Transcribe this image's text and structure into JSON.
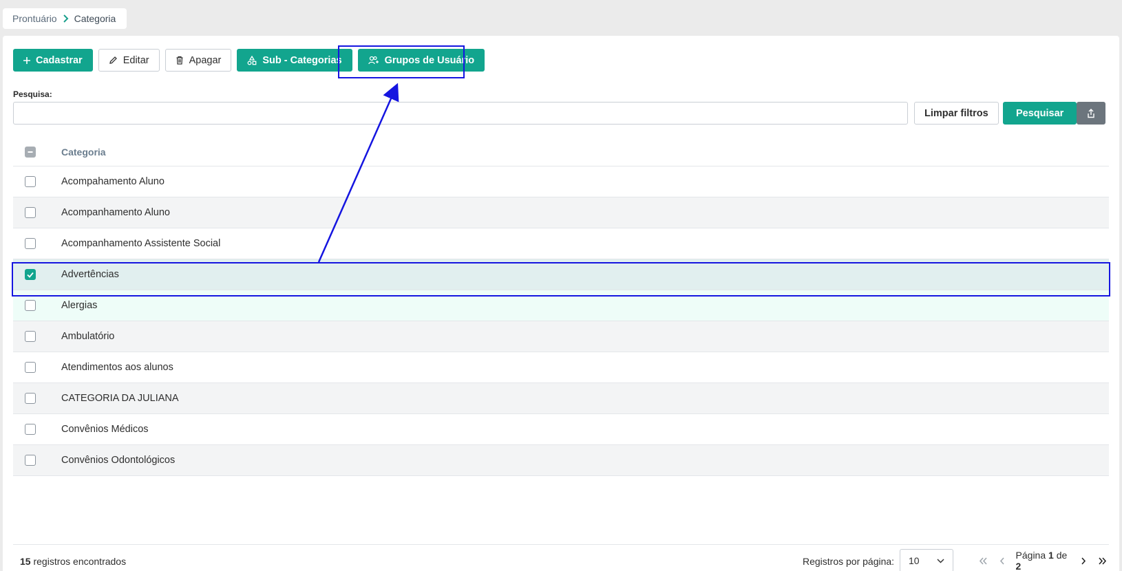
{
  "breadcrumb": {
    "parent": "Prontuário",
    "current": "Categoria"
  },
  "toolbar": {
    "cadastrar": "Cadastrar",
    "editar": "Editar",
    "apagar": "Apagar",
    "subcategorias": "Sub - Categorias",
    "grupos": "Grupos de Usuário"
  },
  "search": {
    "label": "Pesquisa:",
    "value": "",
    "placeholder": "",
    "clear_label": "Limpar filtros",
    "search_label": "Pesquisar"
  },
  "table": {
    "header": "Categoria",
    "rows": [
      {
        "label": "Acompahamento Aluno",
        "checked": false
      },
      {
        "label": "Acompanhamento Aluno",
        "checked": false
      },
      {
        "label": "Acompanhamento Assistente Social",
        "checked": false
      },
      {
        "label": "Advertências",
        "checked": true
      },
      {
        "label": "Alergias",
        "checked": false
      },
      {
        "label": "Ambulatório",
        "checked": false
      },
      {
        "label": "Atendimentos aos alunos",
        "checked": false
      },
      {
        "label": "CATEGORIA DA JULIANA",
        "checked": false
      },
      {
        "label": "Convênios Médicos",
        "checked": false
      },
      {
        "label": "Convênios Odontológicos",
        "checked": false
      }
    ]
  },
  "footer": {
    "count": "15",
    "count_suffix": "registros encontrados",
    "per_page_label": "Registros por página:",
    "per_page_value": "10",
    "page_prefix": "Página",
    "page_current": "1",
    "page_of": "de",
    "page_total": "2"
  },
  "colors": {
    "accent": "#12a58e",
    "annotation": "#1515e0",
    "selected_row": "#e1efef"
  }
}
